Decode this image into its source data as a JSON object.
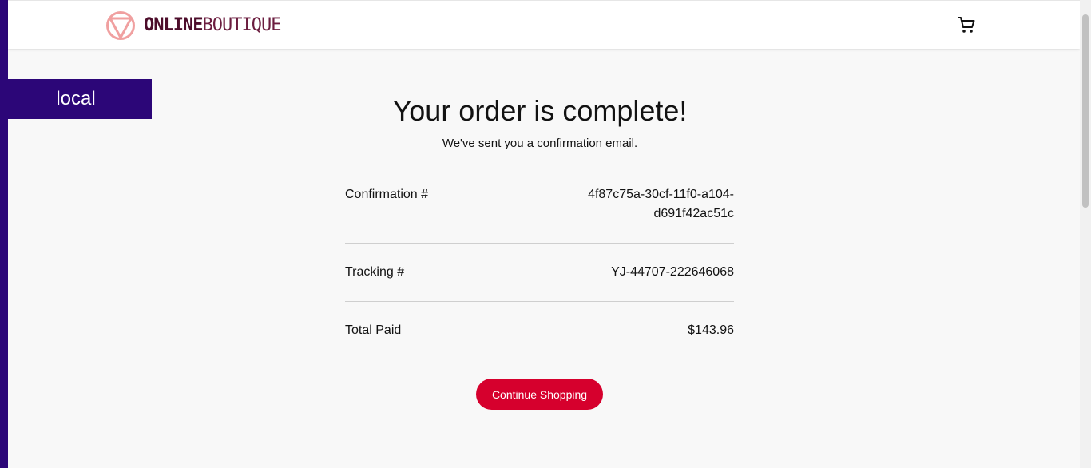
{
  "header": {
    "logo_text_bold": "ONLINE",
    "logo_text_light": "BOUTIQUE",
    "logo_icon": "triangle-circle-logo-icon",
    "cart_icon": "shopping-cart-icon"
  },
  "environment_badge": "local",
  "order": {
    "title": "Your order is complete!",
    "subtitle": "We've sent you a confirmation email.",
    "confirmation_label": "Confirmation #",
    "confirmation_value_line1": "4f87c75a-30cf-11f0-a104-",
    "confirmation_value_line2": "d691f42ac51c",
    "tracking_label": "Tracking #",
    "tracking_value": "YJ-44707-222646068",
    "total_label": "Total Paid",
    "total_value": "$143.96"
  },
  "actions": {
    "continue_label": "Continue Shopping"
  },
  "colors": {
    "brand_dark": "#4d0d2b",
    "logo_pink": "#f0a0a0",
    "env_badge": "#2c0678",
    "accent_button": "#d6002d",
    "background": "#f8f8f8"
  }
}
